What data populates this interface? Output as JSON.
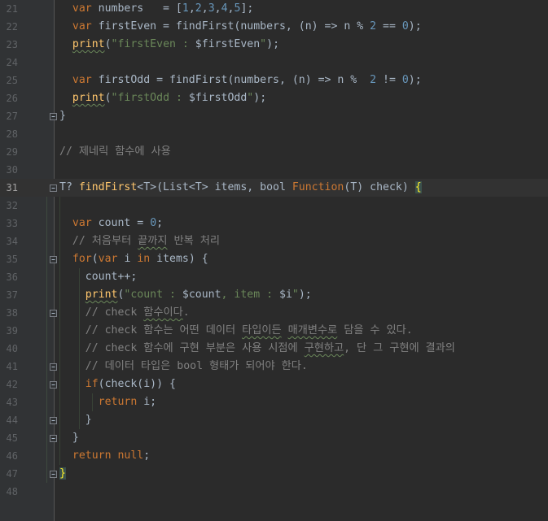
{
  "editor": {
    "colors": {
      "background": "#2b2b2b",
      "gutter": "#313335",
      "line_number": "#606366",
      "keyword": "#cc7832",
      "number": "#6897bb",
      "string": "#6a8759",
      "function": "#ffc66d",
      "comment": "#808080",
      "default": "#a9b7c6"
    },
    "current_line": "31",
    "lines": [
      {
        "n": "21",
        "tokens": [
          {
            "t": "  ",
            "c": ""
          },
          {
            "t": "var",
            "c": "kw"
          },
          {
            "t": " numbers   = [",
            "c": ""
          },
          {
            "t": "1",
            "c": "num"
          },
          {
            "t": ",",
            "c": ""
          },
          {
            "t": "2",
            "c": "num"
          },
          {
            "t": ",",
            "c": ""
          },
          {
            "t": "3",
            "c": "num"
          },
          {
            "t": ",",
            "c": ""
          },
          {
            "t": "4",
            "c": "num"
          },
          {
            "t": ",",
            "c": ""
          },
          {
            "t": "5",
            "c": "num"
          },
          {
            "t": "];",
            "c": ""
          }
        ]
      },
      {
        "n": "22",
        "tokens": [
          {
            "t": "  ",
            "c": ""
          },
          {
            "t": "var",
            "c": "kw"
          },
          {
            "t": " firstEven = findFirst(numbers, (n) => n % ",
            "c": ""
          },
          {
            "t": "2",
            "c": "num"
          },
          {
            "t": " == ",
            "c": ""
          },
          {
            "t": "0",
            "c": "num"
          },
          {
            "t": ");",
            "c": ""
          }
        ]
      },
      {
        "n": "23",
        "tokens": [
          {
            "t": "  ",
            "c": ""
          },
          {
            "t": "print",
            "c": "fn sq"
          },
          {
            "t": "(",
            "c": ""
          },
          {
            "t": "\"firstEven : ",
            "c": "str"
          },
          {
            "t": "$firstEven",
            "c": ""
          },
          {
            "t": "\"",
            "c": "str"
          },
          {
            "t": ");",
            "c": ""
          }
        ]
      },
      {
        "n": "24",
        "tokens": []
      },
      {
        "n": "25",
        "tokens": [
          {
            "t": "  ",
            "c": ""
          },
          {
            "t": "var",
            "c": "kw"
          },
          {
            "t": " firstOdd = findFirst(numbers, (n) => n %  ",
            "c": ""
          },
          {
            "t": "2",
            "c": "num"
          },
          {
            "t": " != ",
            "c": ""
          },
          {
            "t": "0",
            "c": "num"
          },
          {
            "t": ");",
            "c": ""
          }
        ]
      },
      {
        "n": "26",
        "tokens": [
          {
            "t": "  ",
            "c": ""
          },
          {
            "t": "print",
            "c": "fn sq"
          },
          {
            "t": "(",
            "c": ""
          },
          {
            "t": "\"firstOdd : ",
            "c": "str"
          },
          {
            "t": "$firstOdd",
            "c": ""
          },
          {
            "t": "\"",
            "c": "str"
          },
          {
            "t": ");",
            "c": ""
          }
        ]
      },
      {
        "n": "27",
        "tokens": [
          {
            "t": "}",
            "c": ""
          }
        ]
      },
      {
        "n": "28",
        "tokens": []
      },
      {
        "n": "29",
        "tokens": [
          {
            "t": "// 제네릭 함수에 사용",
            "c": "cm"
          }
        ]
      },
      {
        "n": "30",
        "tokens": []
      },
      {
        "n": "31",
        "tokens": [
          {
            "t": "T? ",
            "c": ""
          },
          {
            "t": "findFirst",
            "c": "fn"
          },
          {
            "t": "<T>(List<T> items, bool ",
            "c": ""
          },
          {
            "t": "Function",
            "c": "ty"
          },
          {
            "t": "(T) check) ",
            "c": ""
          },
          {
            "t": "{",
            "c": "brace-hl"
          }
        ]
      },
      {
        "n": "32",
        "tokens": []
      },
      {
        "n": "33",
        "tokens": [
          {
            "t": "  ",
            "c": ""
          },
          {
            "t": "var",
            "c": "kw"
          },
          {
            "t": " count = ",
            "c": ""
          },
          {
            "t": "0",
            "c": "num"
          },
          {
            "t": ";",
            "c": ""
          }
        ]
      },
      {
        "n": "34",
        "tokens": [
          {
            "t": "  // 처음부터 ",
            "c": "cm"
          },
          {
            "t": "끝까지",
            "c": "cm sq"
          },
          {
            "t": " 반복 처리",
            "c": "cm"
          }
        ]
      },
      {
        "n": "35",
        "tokens": [
          {
            "t": "  ",
            "c": ""
          },
          {
            "t": "for",
            "c": "kw"
          },
          {
            "t": "(",
            "c": ""
          },
          {
            "t": "var",
            "c": "kw"
          },
          {
            "t": " i ",
            "c": ""
          },
          {
            "t": "in",
            "c": "kw"
          },
          {
            "t": " items) {",
            "c": ""
          }
        ]
      },
      {
        "n": "36",
        "tokens": [
          {
            "t": "    count++;",
            "c": ""
          }
        ]
      },
      {
        "n": "37",
        "tokens": [
          {
            "t": "    ",
            "c": ""
          },
          {
            "t": "print",
            "c": "fn sq"
          },
          {
            "t": "(",
            "c": ""
          },
          {
            "t": "\"count : ",
            "c": "str"
          },
          {
            "t": "$count",
            "c": ""
          },
          {
            "t": ", item : ",
            "c": "str"
          },
          {
            "t": "$i",
            "c": ""
          },
          {
            "t": "\"",
            "c": "str"
          },
          {
            "t": ");",
            "c": ""
          }
        ]
      },
      {
        "n": "38",
        "tokens": [
          {
            "t": "    // check ",
            "c": "cm"
          },
          {
            "t": "함수이다",
            "c": "cm sq"
          },
          {
            "t": ".",
            "c": "cm"
          }
        ]
      },
      {
        "n": "39",
        "tokens": [
          {
            "t": "    // check 함수는 어떤 데이터 ",
            "c": "cm"
          },
          {
            "t": "타입이든",
            "c": "cm sq"
          },
          {
            "t": " ",
            "c": "cm"
          },
          {
            "t": "매개변수로",
            "c": "cm sq"
          },
          {
            "t": " 담을 수 있다.",
            "c": "cm"
          }
        ]
      },
      {
        "n": "40",
        "tokens": [
          {
            "t": "    // check 함수에 구현 부분은 사용 시점에 ",
            "c": "cm"
          },
          {
            "t": "구현하고",
            "c": "cm sq"
          },
          {
            "t": ", 단 그 구현에 결과의",
            "c": "cm"
          }
        ]
      },
      {
        "n": "41",
        "tokens": [
          {
            "t": "    // 데이터 타입은 bool 형태가 되어야 한다.",
            "c": "cm"
          }
        ]
      },
      {
        "n": "42",
        "tokens": [
          {
            "t": "    ",
            "c": ""
          },
          {
            "t": "if",
            "c": "kw"
          },
          {
            "t": "(check(i)) {",
            "c": ""
          }
        ]
      },
      {
        "n": "43",
        "tokens": [
          {
            "t": "      ",
            "c": ""
          },
          {
            "t": "return",
            "c": "kw"
          },
          {
            "t": " i;",
            "c": ""
          }
        ]
      },
      {
        "n": "44",
        "tokens": [
          {
            "t": "    }",
            "c": ""
          }
        ]
      },
      {
        "n": "45",
        "tokens": [
          {
            "t": "  }",
            "c": ""
          }
        ]
      },
      {
        "n": "46",
        "tokens": [
          {
            "t": "  ",
            "c": ""
          },
          {
            "t": "return",
            "c": "kw"
          },
          {
            "t": " ",
            "c": ""
          },
          {
            "t": "null",
            "c": "kw"
          },
          {
            "t": ";",
            "c": ""
          }
        ]
      },
      {
        "n": "47",
        "tokens": [
          {
            "t": "}",
            "c": "brace-hl"
          }
        ]
      },
      {
        "n": "48",
        "tokens": []
      }
    ]
  }
}
